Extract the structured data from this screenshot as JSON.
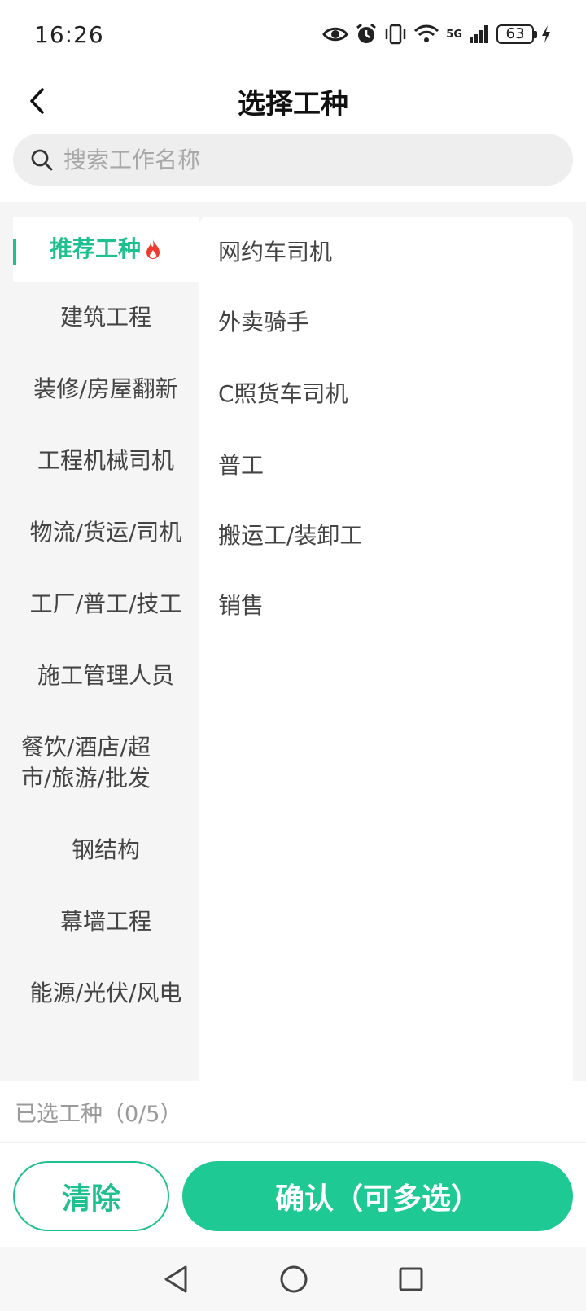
{
  "status_bar": {
    "time": "16:26",
    "network": "5G",
    "battery": "63"
  },
  "header": {
    "title": "选择工种"
  },
  "search": {
    "placeholder": "搜索工作名称",
    "value": ""
  },
  "categories": [
    {
      "label": "推荐工种",
      "active": true
    },
    {
      "label": "建筑工程"
    },
    {
      "label": "装修/房屋翻新"
    },
    {
      "label": "工程机械司机"
    },
    {
      "label": "物流/货运/司机"
    },
    {
      "label": "工厂/普工/技工"
    },
    {
      "label": "施工管理人员"
    },
    {
      "label": "餐饮/酒店/超市/旅游/批发"
    },
    {
      "label": "钢结构"
    },
    {
      "label": "幕墙工程"
    },
    {
      "label": "能源/光伏/风电"
    }
  ],
  "jobs": [
    {
      "label": "网约车司机"
    },
    {
      "label": "外卖骑手"
    },
    {
      "label": "C照货车司机"
    },
    {
      "label": "普工"
    },
    {
      "label": "搬运工/装卸工"
    },
    {
      "label": "销售"
    }
  ],
  "selection": {
    "label": "已选工种（0/5）"
  },
  "actions": {
    "clear_label": "清除",
    "confirm_label": "确认（可多选）"
  },
  "colors": {
    "accent": "#1ec08f",
    "confirm_bg": "#1ec994",
    "fire": "#f03a2e"
  }
}
